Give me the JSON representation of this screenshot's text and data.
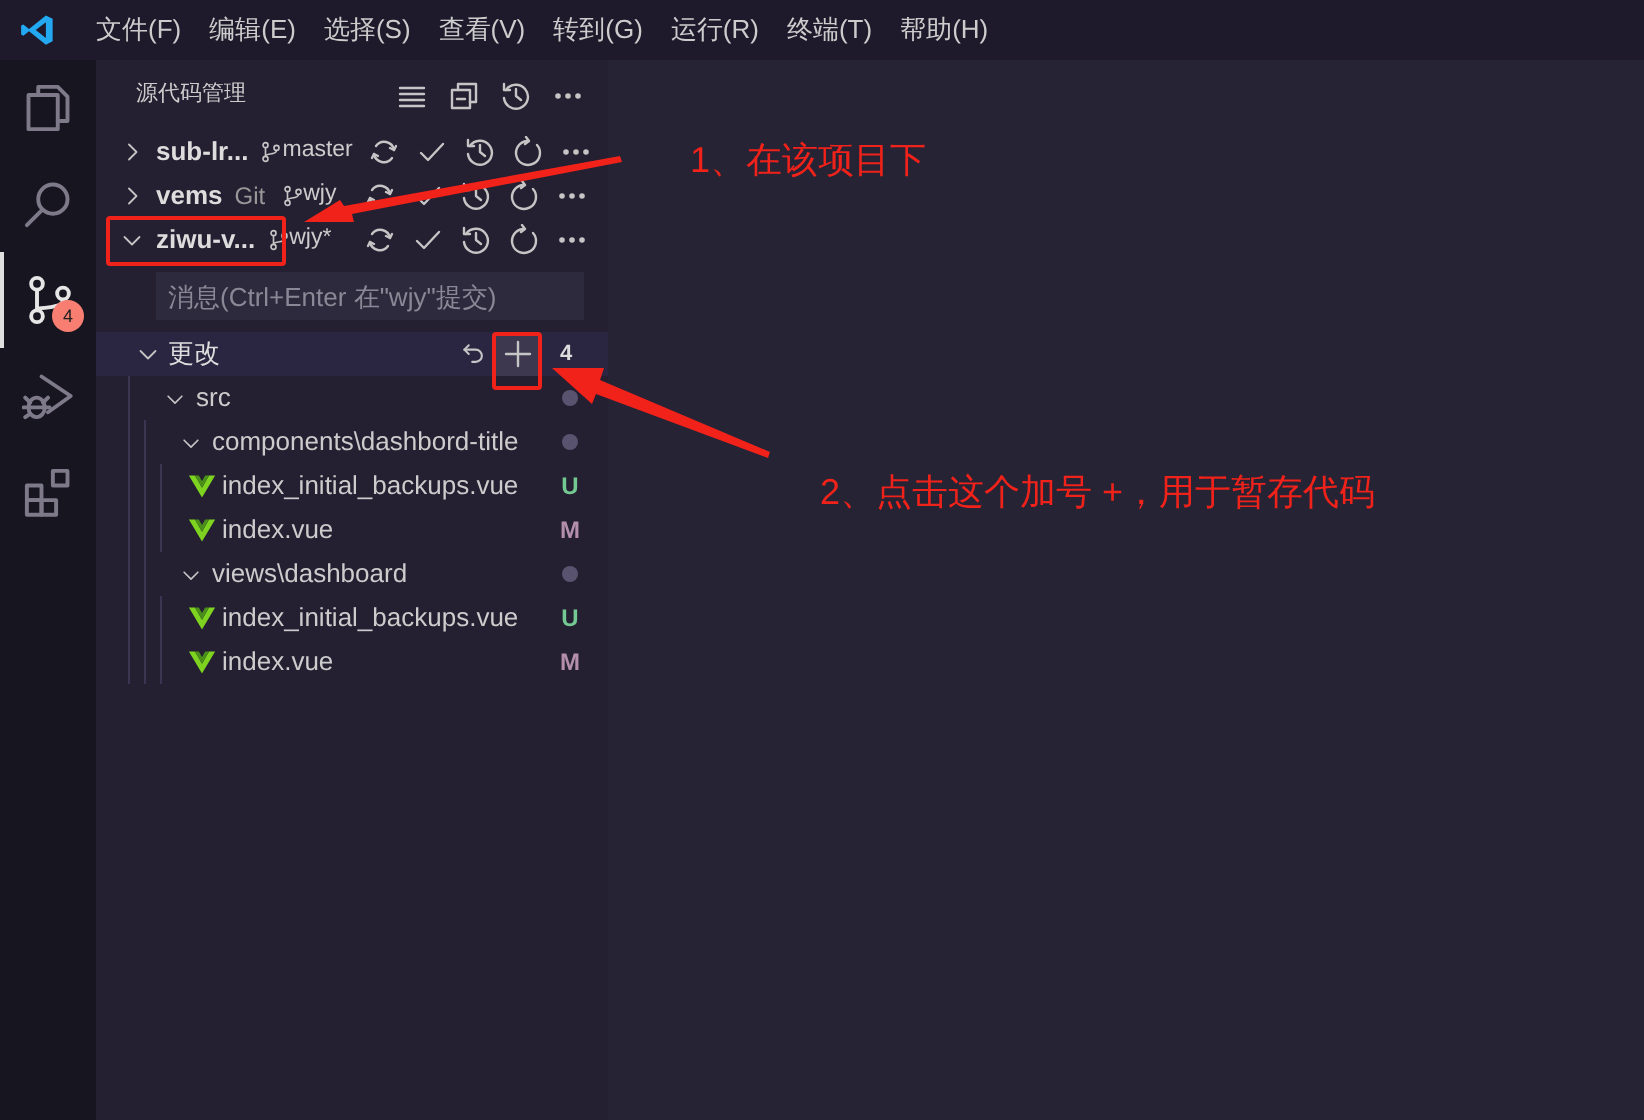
{
  "menu": [
    "文件(F)",
    "编辑(E)",
    "选择(S)",
    "查看(V)",
    "转到(G)",
    "运行(R)",
    "终端(T)",
    "帮助(H)"
  ],
  "activity_bar": [
    {
      "kind": "explorer",
      "selected": false
    },
    {
      "kind": "search",
      "selected": false
    },
    {
      "kind": "scm",
      "selected": true,
      "badge": "4"
    },
    {
      "kind": "debug",
      "selected": false
    },
    {
      "kind": "extensions",
      "selected": false
    }
  ],
  "scm": {
    "title": "源代码管理",
    "repositories": [
      {
        "name": "sub-lr...",
        "branch": "master",
        "expanded": false
      },
      {
        "name": "vems",
        "provider": "Git",
        "branch": "wjy",
        "expanded": false
      },
      {
        "name": "ziwu-v...",
        "branch": "wjy*",
        "expanded": true
      }
    ],
    "commit_message": {
      "placeholder": "消息(Ctrl+Enter 在\"wjy\"提交)"
    },
    "changes": {
      "label": "更改",
      "count": "4",
      "expanded": true,
      "tree": [
        {
          "kind": "folder",
          "name": "src",
          "expanded": true,
          "children": [
            {
              "kind": "folder",
              "name": "components\\dashbord-title",
              "expanded": true,
              "children": [
                {
                  "kind": "file",
                  "name": "index_initial_backups.vue",
                  "status": "U",
                  "color": "#73c991"
                },
                {
                  "kind": "file",
                  "name": "index.vue",
                  "status": "M",
                  "color": "#b48ead"
                }
              ]
            },
            {
              "kind": "folder",
              "name": "views\\dashboard",
              "expanded": true,
              "children": [
                {
                  "kind": "file",
                  "name": "index_initial_backups.vue",
                  "status": "U",
                  "color": "#73c991"
                },
                {
                  "kind": "file",
                  "name": "index.vue",
                  "status": "M",
                  "color": "#b48ead"
                }
              ]
            }
          ]
        }
      ]
    }
  },
  "annotations": [
    {
      "text": "1、在该项目下"
    },
    {
      "text": "2、点击这个加号 +，用于暂存代码"
    }
  ]
}
